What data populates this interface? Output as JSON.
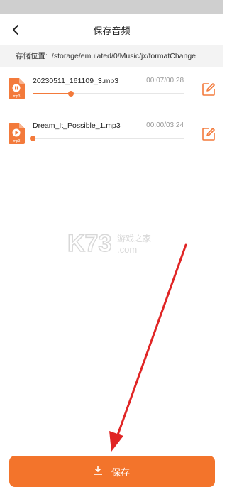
{
  "header": {
    "title": "保存音频"
  },
  "storage": {
    "label": "存储位置:",
    "path": "/storage/emulated/0/Music/jx/formatChange"
  },
  "files": [
    {
      "name": "20230511_161109_3.mp3",
      "time": "00:07/00:28",
      "progress_fraction": 0.25,
      "icon_badge": "mp3",
      "state": "paused"
    },
    {
      "name": "Dream_It_Possible_1.mp3",
      "time": "00:00/03:24",
      "progress_fraction": 0.0,
      "icon_badge": "mp3",
      "state": "stopped"
    }
  ],
  "watermark": {
    "brand": "K73",
    "cn": "游戏之家",
    "domain": ".com"
  },
  "save_button": {
    "label": "保存"
  },
  "colors": {
    "accent": "#f3742b",
    "arrow": "#e02525"
  },
  "icons": {
    "back": "back-arrow-icon",
    "file": "audio-file-icon",
    "edit": "edit-icon",
    "download": "download-icon"
  }
}
